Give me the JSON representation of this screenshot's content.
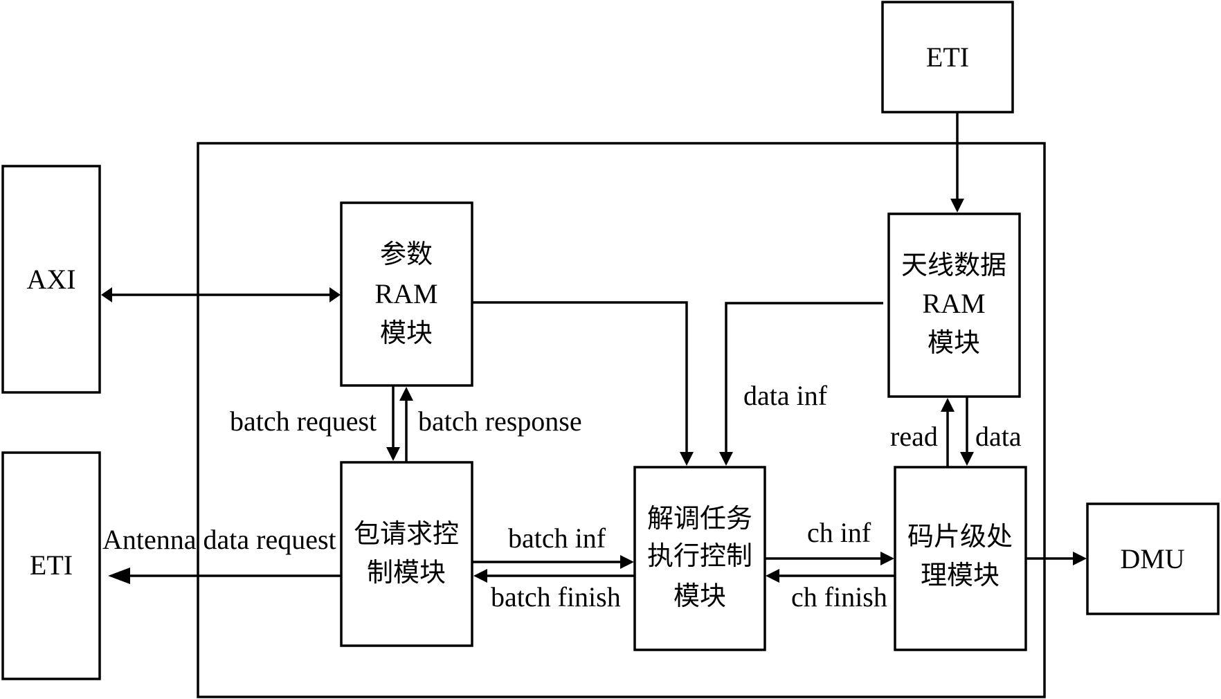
{
  "diagram": {
    "external": {
      "axi": {
        "label": "AXI"
      },
      "eti_left": {
        "label": "ETI"
      },
      "eti_top": {
        "label": "ETI"
      },
      "dmu": {
        "label": "DMU"
      }
    },
    "modules": {
      "param_ram": {
        "lines": [
          "参数",
          "RAM",
          "模块"
        ]
      },
      "packet_request": {
        "lines": [
          "包请求控",
          "制模块"
        ]
      },
      "demod_task": {
        "lines": [
          "解调任务",
          "执行控制",
          "模块"
        ]
      },
      "antenna_ram": {
        "lines": [
          "天线数据",
          "RAM",
          "模块"
        ]
      },
      "chip_processing": {
        "lines": [
          "码片级处",
          "理模块"
        ]
      }
    },
    "signals": {
      "batch_request": "batch request",
      "batch_response": "batch response",
      "antenna_data_request": "Antenna data request",
      "batch_inf": "batch inf",
      "batch_finish": "batch finish",
      "data_inf": "data inf",
      "ch_inf": "ch inf",
      "ch_finish": "ch finish",
      "read": "read",
      "data": "data"
    }
  }
}
